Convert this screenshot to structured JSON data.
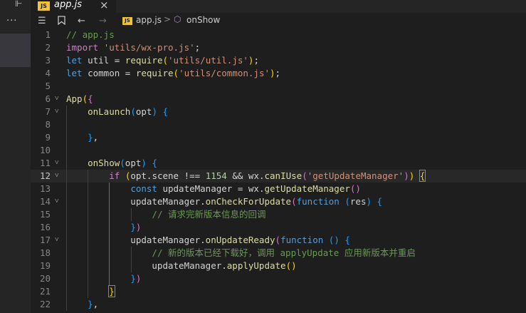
{
  "left_pane": {
    "tab_icon": "split-editor-icon",
    "more_label": "···"
  },
  "tab": {
    "badge": "JS",
    "label": "app.js",
    "close": "×"
  },
  "toolbar": {
    "icons": [
      "list-icon",
      "bookmark-icon",
      "back-arrow-icon",
      "forward-arrow-icon"
    ],
    "breadcrumb": {
      "badge": "JS",
      "file": "app.js",
      "separator": ">",
      "symbol": "onShow",
      "symbol_icon": "cube-icon"
    }
  },
  "colors": {
    "comment": "#6a9955",
    "keyword": "#c586c0",
    "declaration": "#569cd6",
    "string": "#ce9178",
    "function": "#dcdcaa",
    "identifier": "#d4d4d4",
    "number": "#b5cea8",
    "bracket1": "#ffd700",
    "bracket2": "#da70d6",
    "bracket3": "#179fff"
  },
  "editor": {
    "active_line": 12,
    "lines": [
      {
        "n": "1",
        "fold": "",
        "tokens": [
          [
            "c-com",
            "// app.js"
          ]
        ]
      },
      {
        "n": "2",
        "fold": "",
        "tokens": [
          [
            "c-kw",
            "import"
          ],
          [
            "c-id",
            " "
          ],
          [
            "c-str",
            "'utils/wx-pro.js'"
          ],
          [
            "c-id",
            ";"
          ]
        ]
      },
      {
        "n": "3",
        "fold": "",
        "tokens": [
          [
            "c-dec",
            "let"
          ],
          [
            "c-id",
            " util = "
          ],
          [
            "c-fn",
            "require"
          ],
          [
            "c-br1",
            "("
          ],
          [
            "c-str",
            "'utils/util.js'"
          ],
          [
            "c-br1",
            ")"
          ],
          [
            "c-id",
            ";"
          ]
        ]
      },
      {
        "n": "4",
        "fold": "",
        "tokens": [
          [
            "c-dec",
            "let"
          ],
          [
            "c-id",
            " common = "
          ],
          [
            "c-fn",
            "require"
          ],
          [
            "c-br1",
            "("
          ],
          [
            "c-str",
            "'utils/common.js'"
          ],
          [
            "c-br1",
            ")"
          ],
          [
            "c-id",
            ";"
          ]
        ]
      },
      {
        "n": "5",
        "fold": "",
        "tokens": []
      },
      {
        "n": "6",
        "fold": "˅",
        "tokens": [
          [
            "c-fn",
            "App"
          ],
          [
            "c-br1",
            "("
          ],
          [
            "c-br2",
            "{"
          ]
        ]
      },
      {
        "n": "7",
        "fold": "˅",
        "tokens": [
          [
            "c-id",
            "    "
          ],
          [
            "c-fn",
            "onLaunch"
          ],
          [
            "c-br3",
            "("
          ],
          [
            "c-id",
            "opt"
          ],
          [
            "c-br3",
            ")"
          ],
          [
            "c-id",
            " "
          ],
          [
            "c-br3",
            "{"
          ]
        ]
      },
      {
        "n": "8",
        "fold": "",
        "tokens": []
      },
      {
        "n": "9",
        "fold": "",
        "tokens": [
          [
            "c-id",
            "    "
          ],
          [
            "c-br3",
            "}"
          ],
          [
            "c-id",
            ","
          ]
        ]
      },
      {
        "n": "10",
        "fold": "",
        "tokens": []
      },
      {
        "n": "11",
        "fold": "˅",
        "tokens": [
          [
            "c-id",
            "    "
          ],
          [
            "c-fn",
            "onShow"
          ],
          [
            "c-br3",
            "("
          ],
          [
            "c-id",
            "opt"
          ],
          [
            "c-br3",
            ")"
          ],
          [
            "c-id",
            " "
          ],
          [
            "c-br3",
            "{"
          ]
        ]
      },
      {
        "n": "12",
        "fold": "˅",
        "tokens": [
          [
            "c-id",
            "        "
          ],
          [
            "c-kw",
            "if"
          ],
          [
            "c-id",
            " "
          ],
          [
            "c-br1",
            "("
          ],
          [
            "c-id",
            "opt.scene !== "
          ],
          [
            "c-num",
            "1154"
          ],
          [
            "c-id",
            " && wx."
          ],
          [
            "c-fn",
            "canIUse"
          ],
          [
            "c-br2",
            "("
          ],
          [
            "c-str",
            "'getUpdateManager'"
          ],
          [
            "c-br2",
            ")"
          ],
          [
            "c-br1",
            ")"
          ],
          [
            "c-id",
            " "
          ],
          [
            "c-br1 bracket-box",
            "{"
          ]
        ]
      },
      {
        "n": "13",
        "fold": "",
        "tokens": [
          [
            "c-id",
            "            "
          ],
          [
            "c-dec",
            "const"
          ],
          [
            "c-id",
            " updateManager = wx."
          ],
          [
            "c-fn",
            "getUpdateManager"
          ],
          [
            "c-br2",
            "()"
          ]
        ]
      },
      {
        "n": "14",
        "fold": "˅",
        "tokens": [
          [
            "c-id",
            "            updateManager."
          ],
          [
            "c-fn",
            "onCheckForUpdate"
          ],
          [
            "c-br2",
            "("
          ],
          [
            "c-dec",
            "function"
          ],
          [
            "c-id",
            " "
          ],
          [
            "c-br3",
            "("
          ],
          [
            "c-id",
            "res"
          ],
          [
            "c-br3",
            ")"
          ],
          [
            "c-id",
            " "
          ],
          [
            "c-br3",
            "{"
          ]
        ]
      },
      {
        "n": "15",
        "fold": "",
        "tokens": [
          [
            "c-id",
            "                "
          ],
          [
            "c-com",
            "// 请求完新版本信息的回调"
          ]
        ]
      },
      {
        "n": "16",
        "fold": "",
        "tokens": [
          [
            "c-id",
            "            "
          ],
          [
            "c-br3",
            "}"
          ],
          [
            "c-br2",
            ")"
          ]
        ]
      },
      {
        "n": "17",
        "fold": "˅",
        "tokens": [
          [
            "c-id",
            "            updateManager."
          ],
          [
            "c-fn",
            "onUpdateReady"
          ],
          [
            "c-br2",
            "("
          ],
          [
            "c-dec",
            "function"
          ],
          [
            "c-id",
            " "
          ],
          [
            "c-br3",
            "()"
          ],
          [
            "c-id",
            " "
          ],
          [
            "c-br3",
            "{"
          ]
        ]
      },
      {
        "n": "18",
        "fold": "",
        "tokens": [
          [
            "c-id",
            "                "
          ],
          [
            "c-com",
            "// 新的版本已经下载好，调用 applyUpdate 应用新版本并重启"
          ]
        ]
      },
      {
        "n": "19",
        "fold": "",
        "tokens": [
          [
            "c-id",
            "                updateManager."
          ],
          [
            "c-fn",
            "applyUpdate"
          ],
          [
            "c-br1",
            "()"
          ]
        ]
      },
      {
        "n": "20",
        "fold": "",
        "tokens": [
          [
            "c-id",
            "            "
          ],
          [
            "c-br3",
            "}"
          ],
          [
            "c-br2",
            ")"
          ]
        ]
      },
      {
        "n": "21",
        "fold": "",
        "tokens": [
          [
            "c-id",
            "        "
          ],
          [
            "c-br1 bracket-box",
            "}"
          ]
        ]
      },
      {
        "n": "22",
        "fold": "",
        "tokens": [
          [
            "c-id",
            "    "
          ],
          [
            "c-br3",
            "}"
          ],
          [
            "c-id",
            ","
          ]
        ]
      }
    ]
  }
}
